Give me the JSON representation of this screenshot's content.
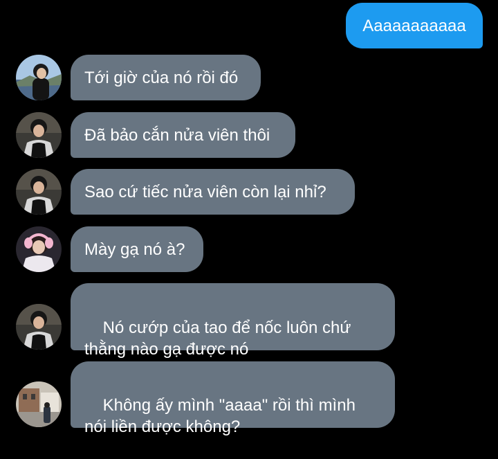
{
  "messages": [
    {
      "id": "m0",
      "direction": "outgoing",
      "text": "Aaaaaaaaaaa"
    },
    {
      "id": "m1",
      "direction": "incoming",
      "text": "Tới giờ của nó rồi đó",
      "avatar": "avatar-lake-photo"
    },
    {
      "id": "m2",
      "direction": "incoming",
      "text": "Đã bảo cắn nửa viên thôi",
      "avatar": "avatar-black-shirt-photo"
    },
    {
      "id": "m3",
      "direction": "incoming",
      "text": "Sao cứ tiếc nửa viên còn lại nhỉ?",
      "avatar": "avatar-black-shirt-photo"
    },
    {
      "id": "m4",
      "direction": "incoming",
      "text": "Mày gạ nó à?",
      "avatar": "avatar-pink-headphones-photo"
    },
    {
      "id": "m5",
      "direction": "incoming",
      "text": "Nó cướp của tao để nốc luôn chứ thằng nào gạ được nó",
      "avatar": "avatar-black-shirt-photo"
    },
    {
      "id": "m6",
      "direction": "incoming",
      "text": "Không ấy mình \"aaaa\" rồi thì mình nói liền được không?",
      "avatar": "avatar-street-photo"
    }
  ],
  "colors": {
    "background": "#000000",
    "outgoing_bubble": "#1d9bf0",
    "incoming_bubble": "#687582",
    "text": "#ffffff"
  }
}
